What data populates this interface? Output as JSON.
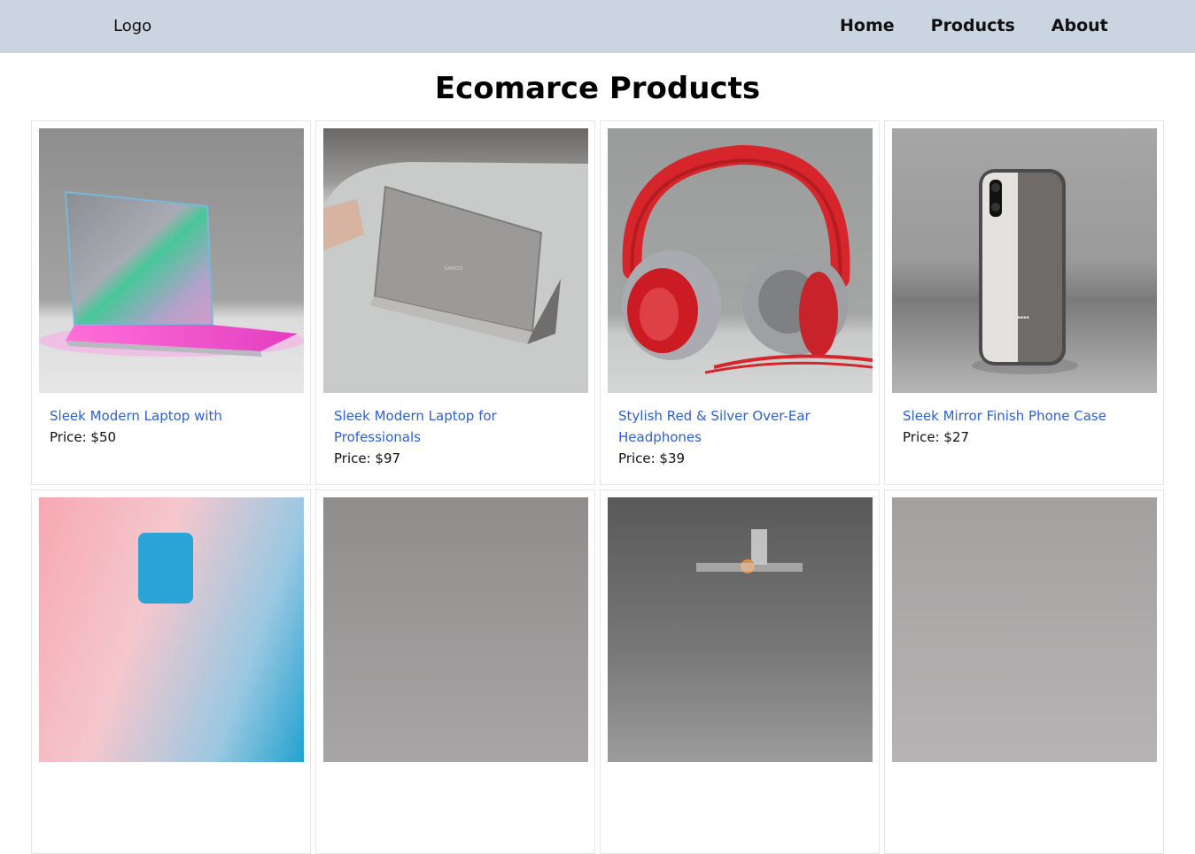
{
  "navbar": {
    "logo": "Logo",
    "links": [
      "Home",
      "Products",
      "About"
    ]
  },
  "page": {
    "title": "Ecomarce Products"
  },
  "products": [
    {
      "title": "Sleek Modern Laptop with",
      "price": "Price: $50",
      "image": "laptop-pink-glow"
    },
    {
      "title": "Sleek Modern Laptop for Professionals",
      "price": "Price: $97",
      "image": "laptop-silver"
    },
    {
      "title": "Stylish Red & Silver Over-Ear Headphones",
      "price": "Price: $39",
      "image": "red-headphones"
    },
    {
      "title": "Sleek Mirror Finish Phone Case",
      "price": "Price: $27",
      "image": "mirror-phone-case"
    }
  ],
  "second_row_images": [
    "pink-blue-product",
    "gray-product",
    "dark-product-with-bottle",
    "gray-product-2"
  ],
  "colors": {
    "navbar_bg": "#cbd5e1",
    "link_blue": "#2b5fd9"
  }
}
